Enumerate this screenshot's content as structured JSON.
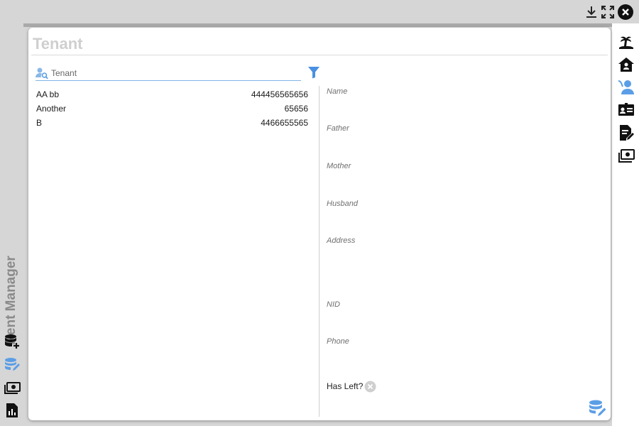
{
  "app": {
    "title": "Rent Manager"
  },
  "window_controls": [
    "download-icon",
    "fullscreen-icon",
    "close-icon"
  ],
  "page": {
    "title": "Tenant"
  },
  "search": {
    "placeholder": "Tenant",
    "value": ""
  },
  "tenants": [
    {
      "name": "AA bb",
      "phone": "444456565656"
    },
    {
      "name": "Another",
      "phone": "65656"
    },
    {
      "name": "B",
      "phone": "4466655565"
    }
  ],
  "form": {
    "name_label": "Name",
    "father_label": "Father",
    "mother_label": "Mother",
    "husband_label": "Husband",
    "address_label": "Address",
    "nid_label": "NID",
    "phone_label": "Phone",
    "has_left_label": "Has Left?",
    "has_left_value": false
  },
  "left_rail_icons": [
    "database-add-icon",
    "database-edit-icon",
    "cash-icon",
    "report-icon"
  ],
  "right_rail_icons": [
    "island-icon",
    "home-icon",
    "tenant-icon",
    "id-card-icon",
    "document-edit-icon",
    "payment-icon"
  ],
  "active_right_icon": "tenant-icon",
  "colors": {
    "accent": "#5b9ee6",
    "title_gray": "#cfcfcf",
    "rail_bg": "#d6d6d6"
  }
}
